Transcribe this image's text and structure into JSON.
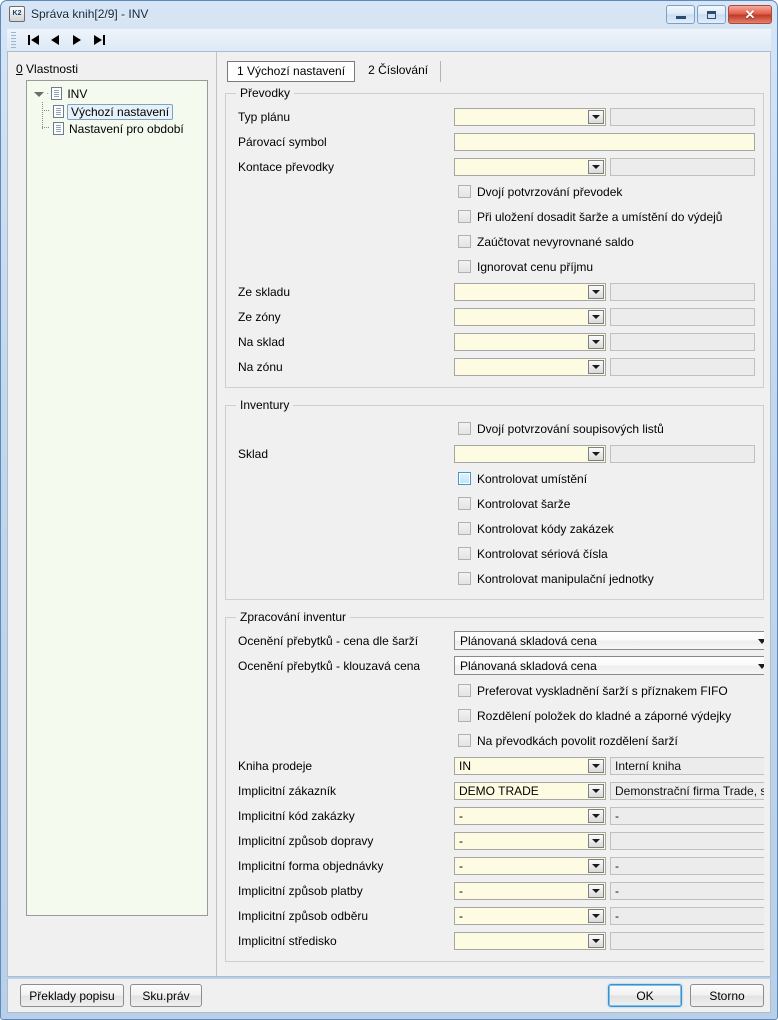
{
  "window": {
    "title": "Správa knih[2/9] - INV",
    "app_icon": "k2-app-icon",
    "minimize_label": "Minimalizovat",
    "maximize_label": "Maximalizovat",
    "close_label": "Zavřít"
  },
  "toolbar": {
    "buttons": [
      {
        "name": "first-record",
        "label": "První záznam"
      },
      {
        "name": "previous-record",
        "label": "Předchozí záznam"
      },
      {
        "name": "next-record",
        "label": "Další záznam"
      },
      {
        "name": "last-record",
        "label": "Poslední záznam"
      }
    ]
  },
  "tree": {
    "caption_accelerator": "0",
    "caption": " Vlastnosti",
    "root": "INV",
    "items": [
      {
        "label": "Výchozí nastavení",
        "selected": true
      },
      {
        "label": "Nastavení pro období",
        "selected": false
      }
    ]
  },
  "tabs": [
    {
      "label": "1 Výchozí nastavení",
      "active": true
    },
    {
      "label": "2 Číslování",
      "active": false
    }
  ],
  "groups": {
    "prevodky": {
      "legend": "Převodky",
      "fields": [
        {
          "label": "Typ plánu",
          "value": "",
          "desc": "",
          "kind": "combo"
        },
        {
          "label": "Párovací symbol",
          "value": "",
          "kind": "text"
        },
        {
          "label": "Kontace převodky",
          "value": "",
          "desc": "",
          "kind": "combo"
        }
      ],
      "checkboxes": [
        {
          "label": "Dvojí potvrzování převodek",
          "checked": false,
          "focused": false
        },
        {
          "label": "Při uložení dosadit šarže a umístění do výdejů",
          "checked": false,
          "focused": false
        },
        {
          "label": "Zaúčtovat nevyrovnané saldo",
          "checked": false,
          "focused": false
        },
        {
          "label": "Ignorovat cenu příjmu",
          "checked": false,
          "focused": false
        }
      ],
      "fields2": [
        {
          "label": "Ze skladu",
          "value": "",
          "desc": "",
          "kind": "combo"
        },
        {
          "label": "Ze zóny",
          "value": "",
          "desc": "",
          "kind": "combo"
        },
        {
          "label": "Na sklad",
          "value": "",
          "desc": "",
          "kind": "combo"
        },
        {
          "label": "Na zónu",
          "value": "",
          "desc": "",
          "kind": "combo"
        }
      ]
    },
    "inventury": {
      "legend": "Inventury",
      "checkbox_top": {
        "label": "Dvojí potvrzování soupisových listů",
        "checked": false,
        "focused": false
      },
      "field_sklad": {
        "label": "Sklad",
        "value": "",
        "desc": "",
        "kind": "combo"
      },
      "checkboxes": [
        {
          "label": "Kontrolovat umístění",
          "checked": false,
          "focused": true
        },
        {
          "label": "Kontrolovat šarže",
          "checked": false,
          "focused": false
        },
        {
          "label": "Kontrolovat kódy zakázek",
          "checked": false,
          "focused": false
        },
        {
          "label": "Kontrolovat sériová čísla",
          "checked": false,
          "focused": false
        },
        {
          "label": "Kontrolovat manipulační jednotky",
          "checked": false,
          "focused": false
        }
      ]
    },
    "zpracovani": {
      "legend": "Zpracování inventur",
      "combos": [
        {
          "label": "Ocenění přebytků - cena dle šarží",
          "value": "Plánovaná skladová cena"
        },
        {
          "label": "Ocenění přebytků - klouzavá cena",
          "value": "Plánovaná skladová cena"
        }
      ],
      "checkboxes": [
        {
          "label": "Preferovat vyskladnění šarží s příznakem FIFO",
          "checked": false,
          "focused": false
        },
        {
          "label": "Rozdělení položek do kladné a záporné výdejky",
          "checked": false,
          "focused": false
        },
        {
          "label": "Na převodkách povolit rozdělení šarží",
          "checked": false,
          "focused": false
        }
      ],
      "fields": [
        {
          "label": "Kniha prodeje",
          "value": "IN",
          "desc": "Interní kniha"
        },
        {
          "label": "Implicitní zákazník",
          "value": "DEMO TRADE",
          "desc": "Demonstrační firma Trade, sp"
        },
        {
          "label": "Implicitní kód zakázky",
          "value": "-",
          "desc": "-"
        },
        {
          "label": "Implicitní způsob dopravy",
          "value": "-",
          "desc": ""
        },
        {
          "label": "Implicitní forma objednávky",
          "value": "-",
          "desc": "-"
        },
        {
          "label": "Implicitní způsob platby",
          "value": "-",
          "desc": "-"
        },
        {
          "label": "Implicitní způsob odběru",
          "value": "-",
          "desc": "-"
        },
        {
          "label": "Implicitní středisko",
          "value": "",
          "desc": ""
        }
      ]
    }
  },
  "footer": {
    "translations_label": "Překlady popisu",
    "rights_label": "Sku.práv",
    "ok_label": "OK",
    "cancel_label": "Storno"
  },
  "colors": {
    "titlebar_start": "#d7e5f5",
    "titlebar_end": "#b9cfe8",
    "edit_yellow": "#fdfce2",
    "readonly_gray": "#ececec",
    "focus_blue": "#3f9ad0",
    "close_red": "#c03a26",
    "tree_bg": "#f4fbee"
  }
}
